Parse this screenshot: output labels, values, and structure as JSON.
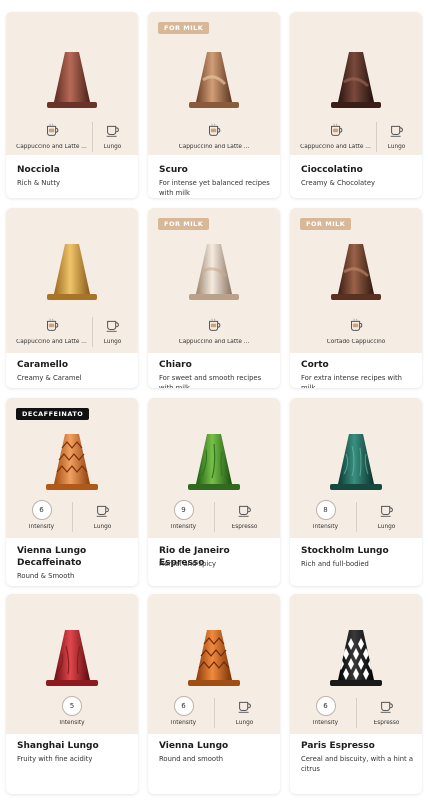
{
  "features": {
    "cappuccino_latte": "Cappuccino and Latte ...",
    "lungo": "Lungo",
    "cortado_cappuccino": "Cortado Cappuccino",
    "intensity": "Intensity",
    "espresso": "Espresso"
  },
  "badges": {
    "for_milk": "FOR MILK",
    "decaffeinato": "DECAFFEINATO"
  },
  "products": [
    {
      "name": "Nocciola",
      "desc": "Rich & Nutty",
      "color": "#8a4a3a"
    },
    {
      "name": "Scuro",
      "desc": "For intense yet balanced recipes with milk",
      "color": "#a8704c"
    },
    {
      "name": "Cioccolatino",
      "desc": "Creamy & Chocolatey",
      "color": "#4a2a22"
    },
    {
      "name": "Caramello",
      "desc": "Creamy & Caramel",
      "color": "#c99240"
    },
    {
      "name": "Chiaro",
      "desc": "For sweet and smooth recipes with milk",
      "color": "#dbc8b4"
    },
    {
      "name": "Corto",
      "desc": "For extra intense recipes with milk",
      "color": "#6b3f2c"
    },
    {
      "name": "Vienna Lungo Decaffeinato",
      "desc": "Round & Smooth",
      "intensity": "6",
      "color": "#d8782e"
    },
    {
      "name": "Rio de Janeiro Espresso",
      "desc": "Herbal and spicy",
      "intensity": "9",
      "color": "#3f8a2a"
    },
    {
      "name": "Stockholm Lungo",
      "desc": "Rich and full-bodied",
      "intensity": "8",
      "color": "#1d5a50"
    },
    {
      "name": "Shanghai Lungo",
      "desc": "Fruity with fine acidity",
      "intensity": "5",
      "color": "#b2232a"
    },
    {
      "name": "Vienna Lungo",
      "desc": "Round and smooth",
      "intensity": "6",
      "color": "#c9641e"
    },
    {
      "name": "Paris Espresso",
      "desc": "Cereal and biscuity, with a hint a citrus",
      "intensity": "6",
      "color": "#1a1a1a"
    }
  ]
}
